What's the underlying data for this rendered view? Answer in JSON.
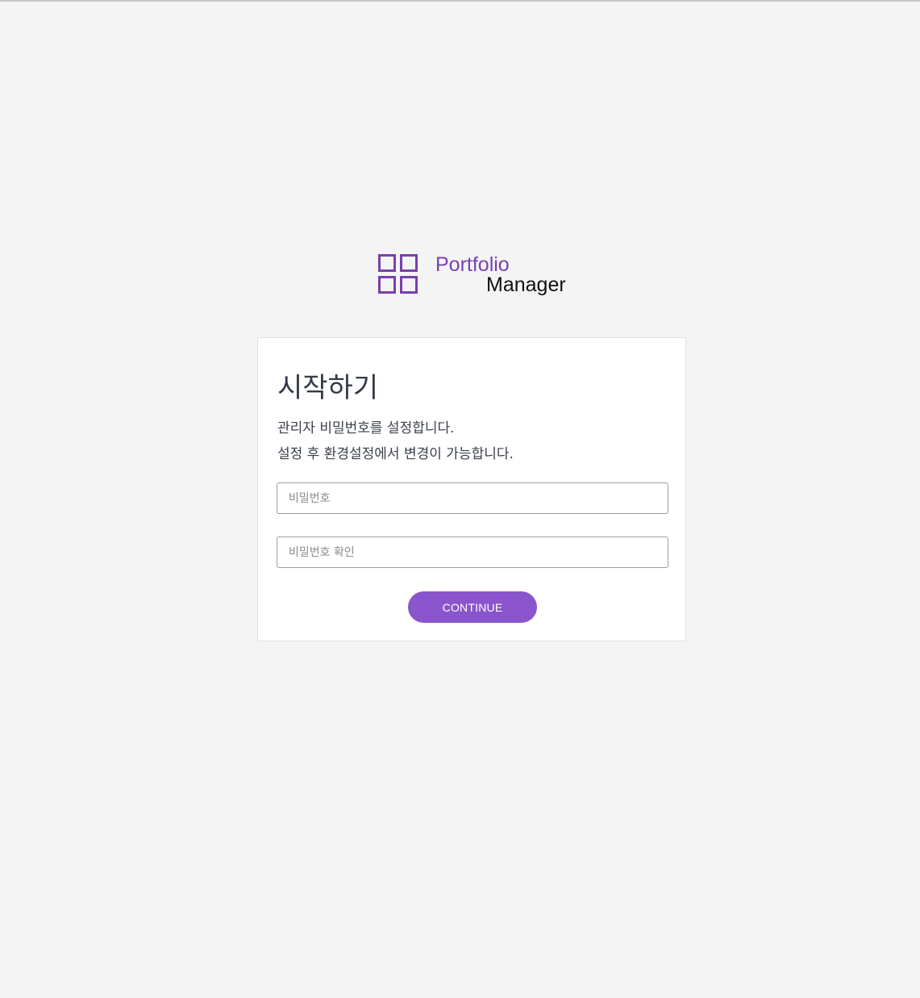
{
  "brand": {
    "line1": "Portfolio",
    "line2": "Manager",
    "logo_icon": "four-squares-grid-icon",
    "accent_color": "#7a3fae"
  },
  "setup": {
    "title": "시작하기",
    "description_line1": "관리자 비밀번호를 설정합니다.",
    "description_line2": "설정 후 환경설정에서 변경이 가능합니다.",
    "password_placeholder": "비밀번호",
    "password_value": "",
    "confirm_placeholder": "비밀번호 확인",
    "confirm_value": "",
    "continue_label": "CONTINUE",
    "button_color": "#8a55cc"
  }
}
